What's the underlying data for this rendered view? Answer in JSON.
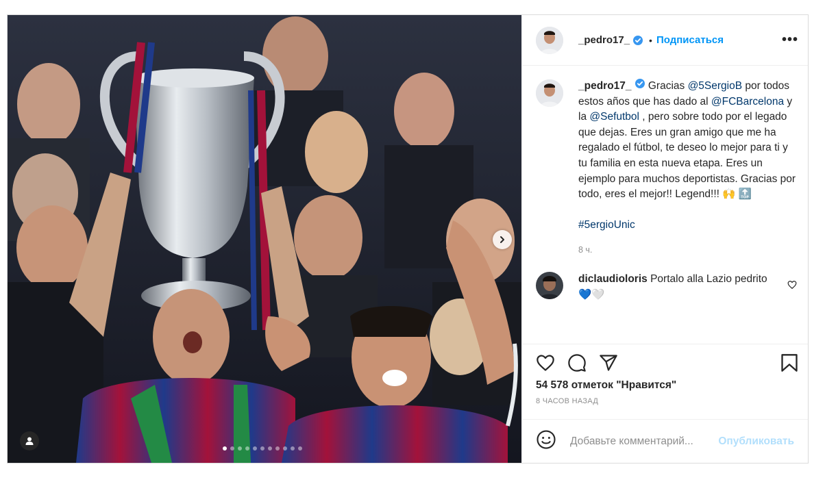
{
  "post": {
    "username": "_pedro17_",
    "follow_label": "Подписаться",
    "separator": "•",
    "more_label": "•••",
    "caption": {
      "username": "_pedro17_",
      "text_1": " Gracias ",
      "mention_1": "@5SergioB",
      "text_2": " por todos estos años que has dado al ",
      "mention_2": "@FCBarcelona",
      "text_3": " y la ",
      "mention_3": "@Sefutbol",
      "text_4": " , pero sobre todo por el legado que dejas. Eres un gran amigo que me ha regalado el fútbol, te deseo lo mejor para ti y tu familia en esta nueva etapa. Eres un ejemplo para muchos deportistas. Gracias por todo, eres el mejor!! Legend!!! 🙌 🔝",
      "hashtag": "#5ergioUnic",
      "time": "8 ч."
    },
    "comments": [
      {
        "username": "diclaudioloris",
        "text": " Portalo alla Lazio pedrito💙🤍"
      }
    ],
    "likes": "54 578 отметок \"Нравится\"",
    "date": "8 ЧАСОВ НАЗАД",
    "composer": {
      "placeholder": "Добавьте комментарий...",
      "publish": "Опубликовать"
    },
    "carousel": {
      "slides": 11,
      "active": 0
    }
  },
  "icons": [
    "verified-badge-icon",
    "more-options-icon",
    "next-slide-icon",
    "tagged-user-icon",
    "heart-icon",
    "comment-icon",
    "share-icon",
    "save-icon",
    "emoji-icon"
  ],
  "colors": {
    "link": "#0095f6",
    "mention": "#00376b",
    "muted": "#8e8e8e",
    "publish_disabled": "#b2dffc",
    "border": "#dbdbdb"
  }
}
